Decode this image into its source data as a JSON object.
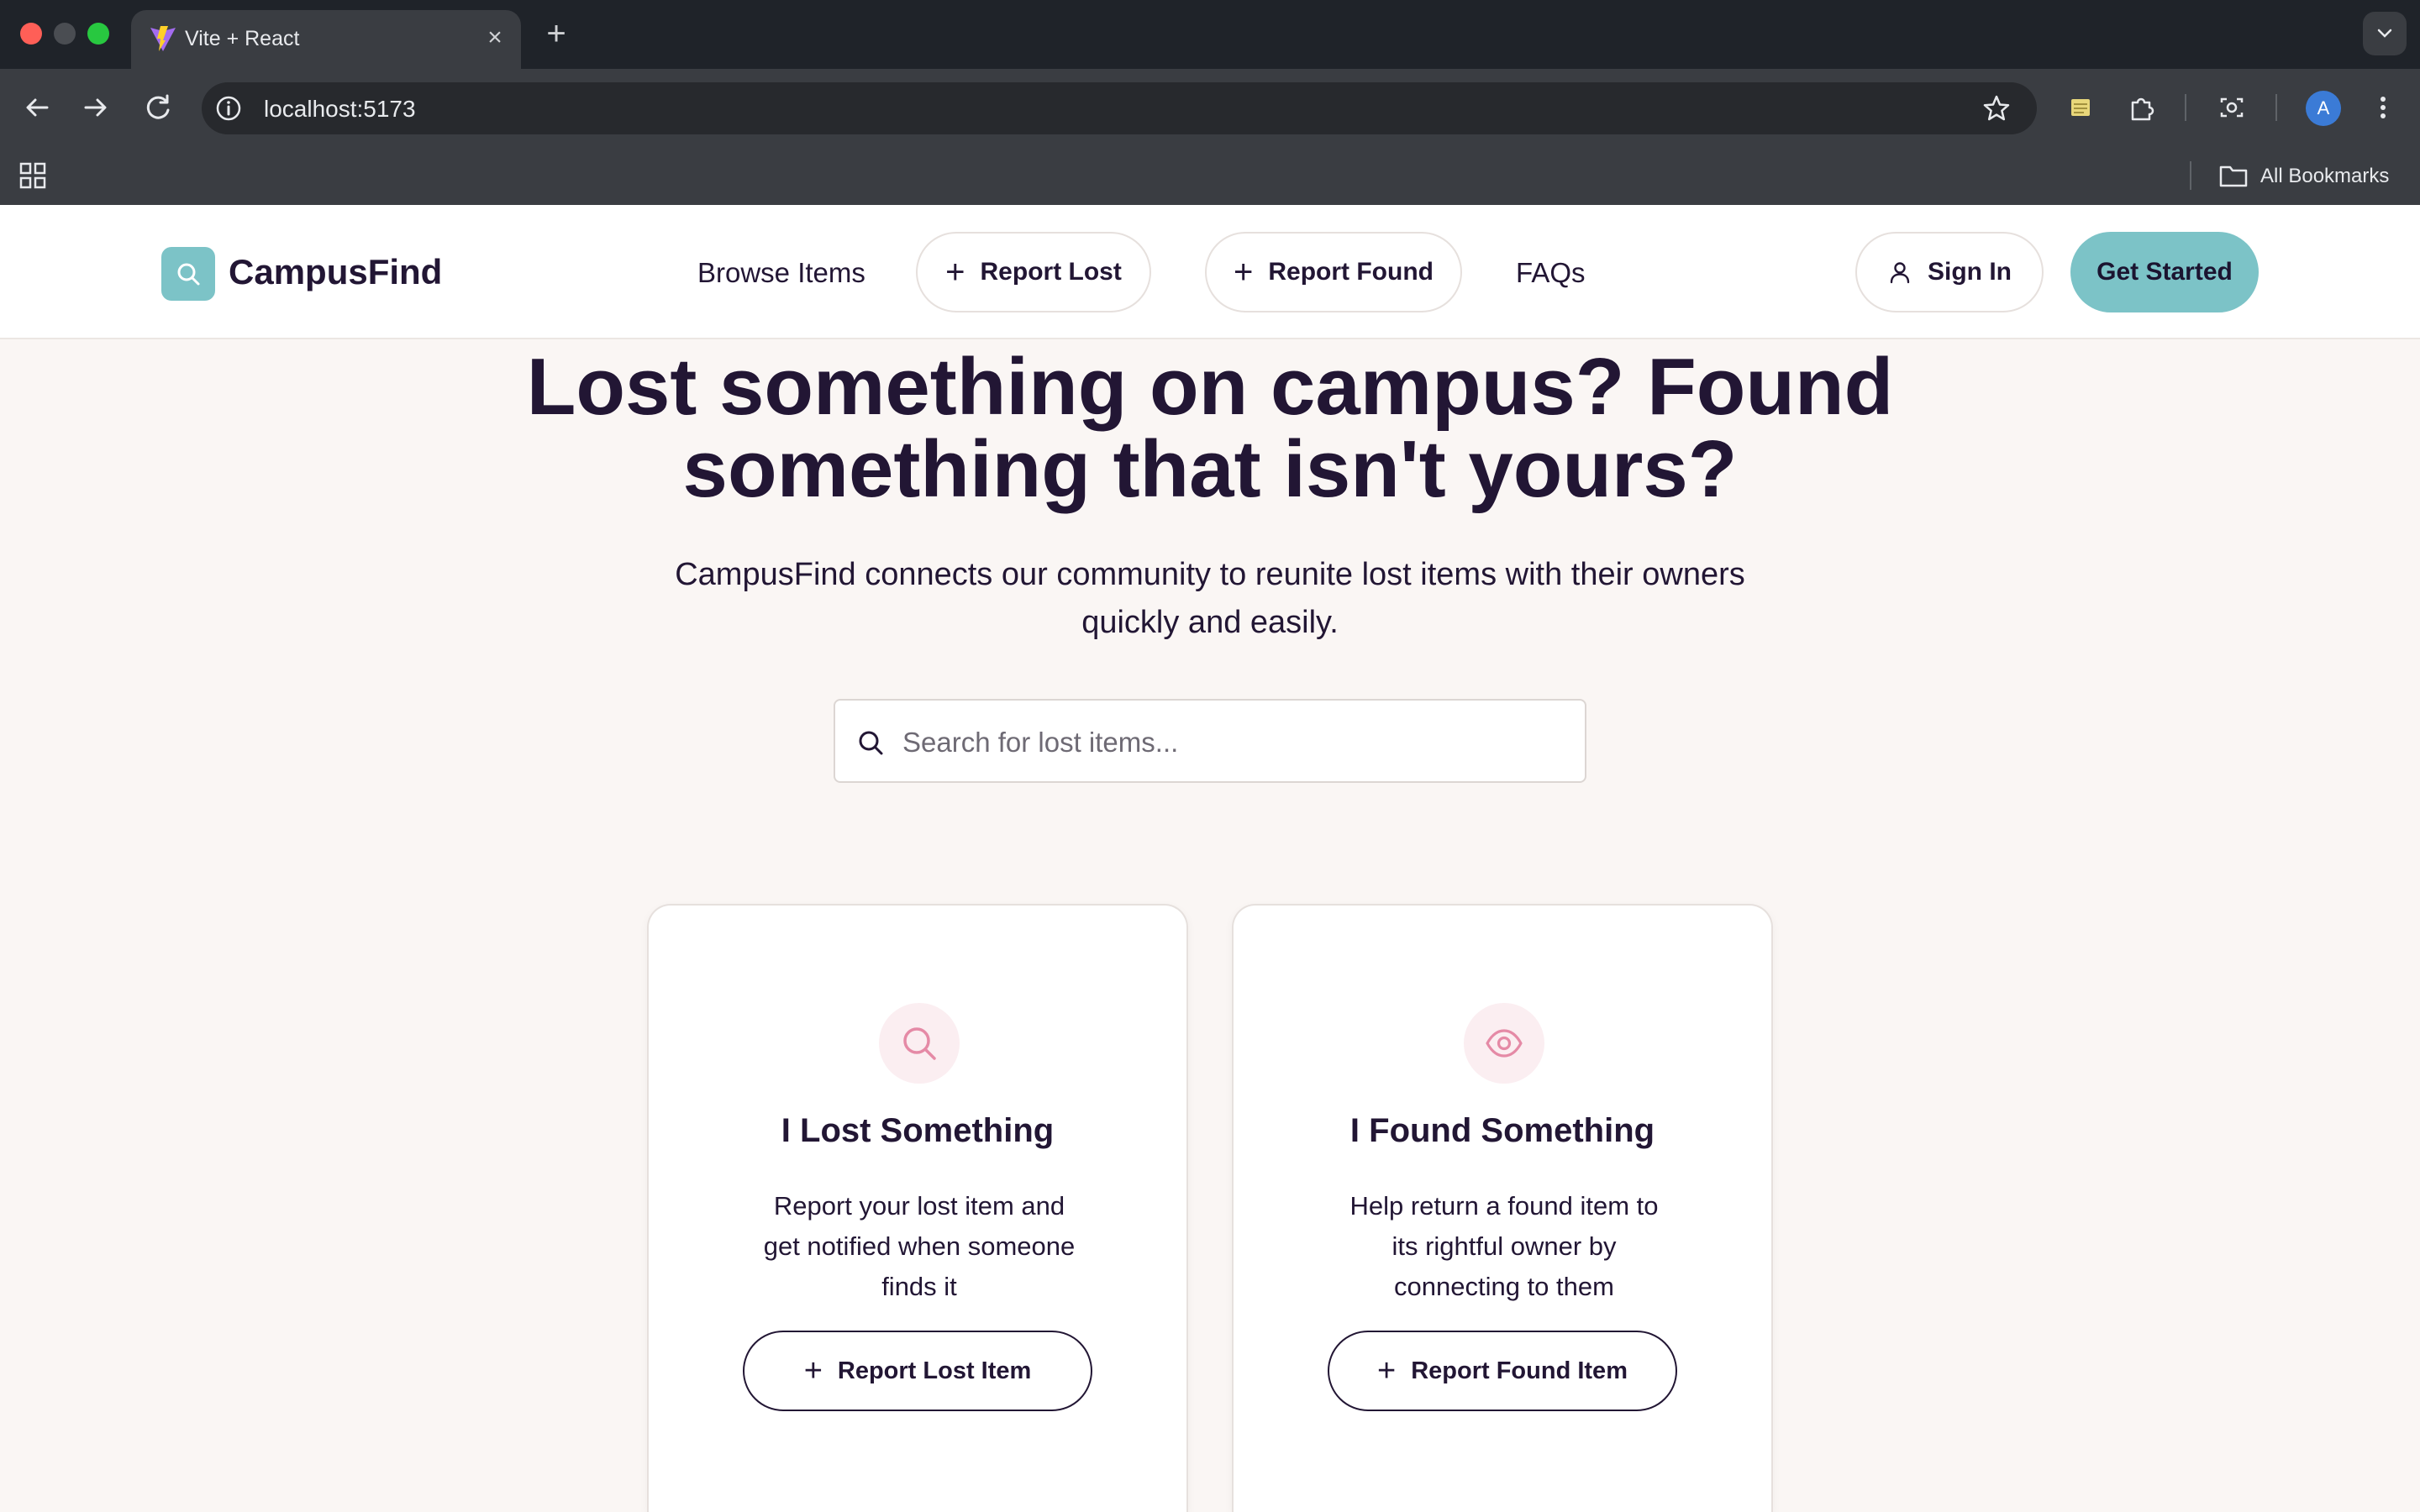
{
  "browser": {
    "tab_title": "Vite + React",
    "tab_close": "×",
    "new_tab": "+",
    "url": "localhost:5173",
    "profile_initial": "A",
    "bookmarks_label": "All Bookmarks",
    "icons": [
      "back-icon",
      "forward-icon",
      "reload-icon",
      "info-icon",
      "star-icon",
      "extensions-icon",
      "screenshot-icon",
      "more-icon",
      "apps-icon",
      "folder-icon"
    ]
  },
  "header": {
    "brand": "CampusFind",
    "nav": {
      "browse": "Browse Items",
      "report_lost": "Report Lost",
      "report_found": "Report Found",
      "faqs": "FAQs"
    },
    "sign_in": "Sign In",
    "get_started": "Get Started",
    "plus": "+"
  },
  "hero": {
    "title_line1": "Lost something on campus? Found",
    "title_line2": "something that isn't yours?",
    "subtitle_line1": "CampusFind connects our community to reunite lost items with their owners",
    "subtitle_line2": "quickly and easily.",
    "search_placeholder": "Search for lost items..."
  },
  "cards": [
    {
      "title": "I Lost Something",
      "desc_line1": "Report your lost item and",
      "desc_line2": "get notified when someone",
      "desc_line3": "finds it",
      "button": "Report Lost Item"
    },
    {
      "title": "I Found Something",
      "desc_line1": "Help return a found item to",
      "desc_line2": "its rightful owner by",
      "desc_line3": "connecting to them",
      "button": "Report Found Item"
    }
  ],
  "colors": {
    "brand_teal": "#7cc3c7",
    "text_dark": "#221634",
    "page_bg": "#faf6f4",
    "icon_pink": "#e58aa6",
    "icon_bg_pink": "#fbeef1"
  }
}
